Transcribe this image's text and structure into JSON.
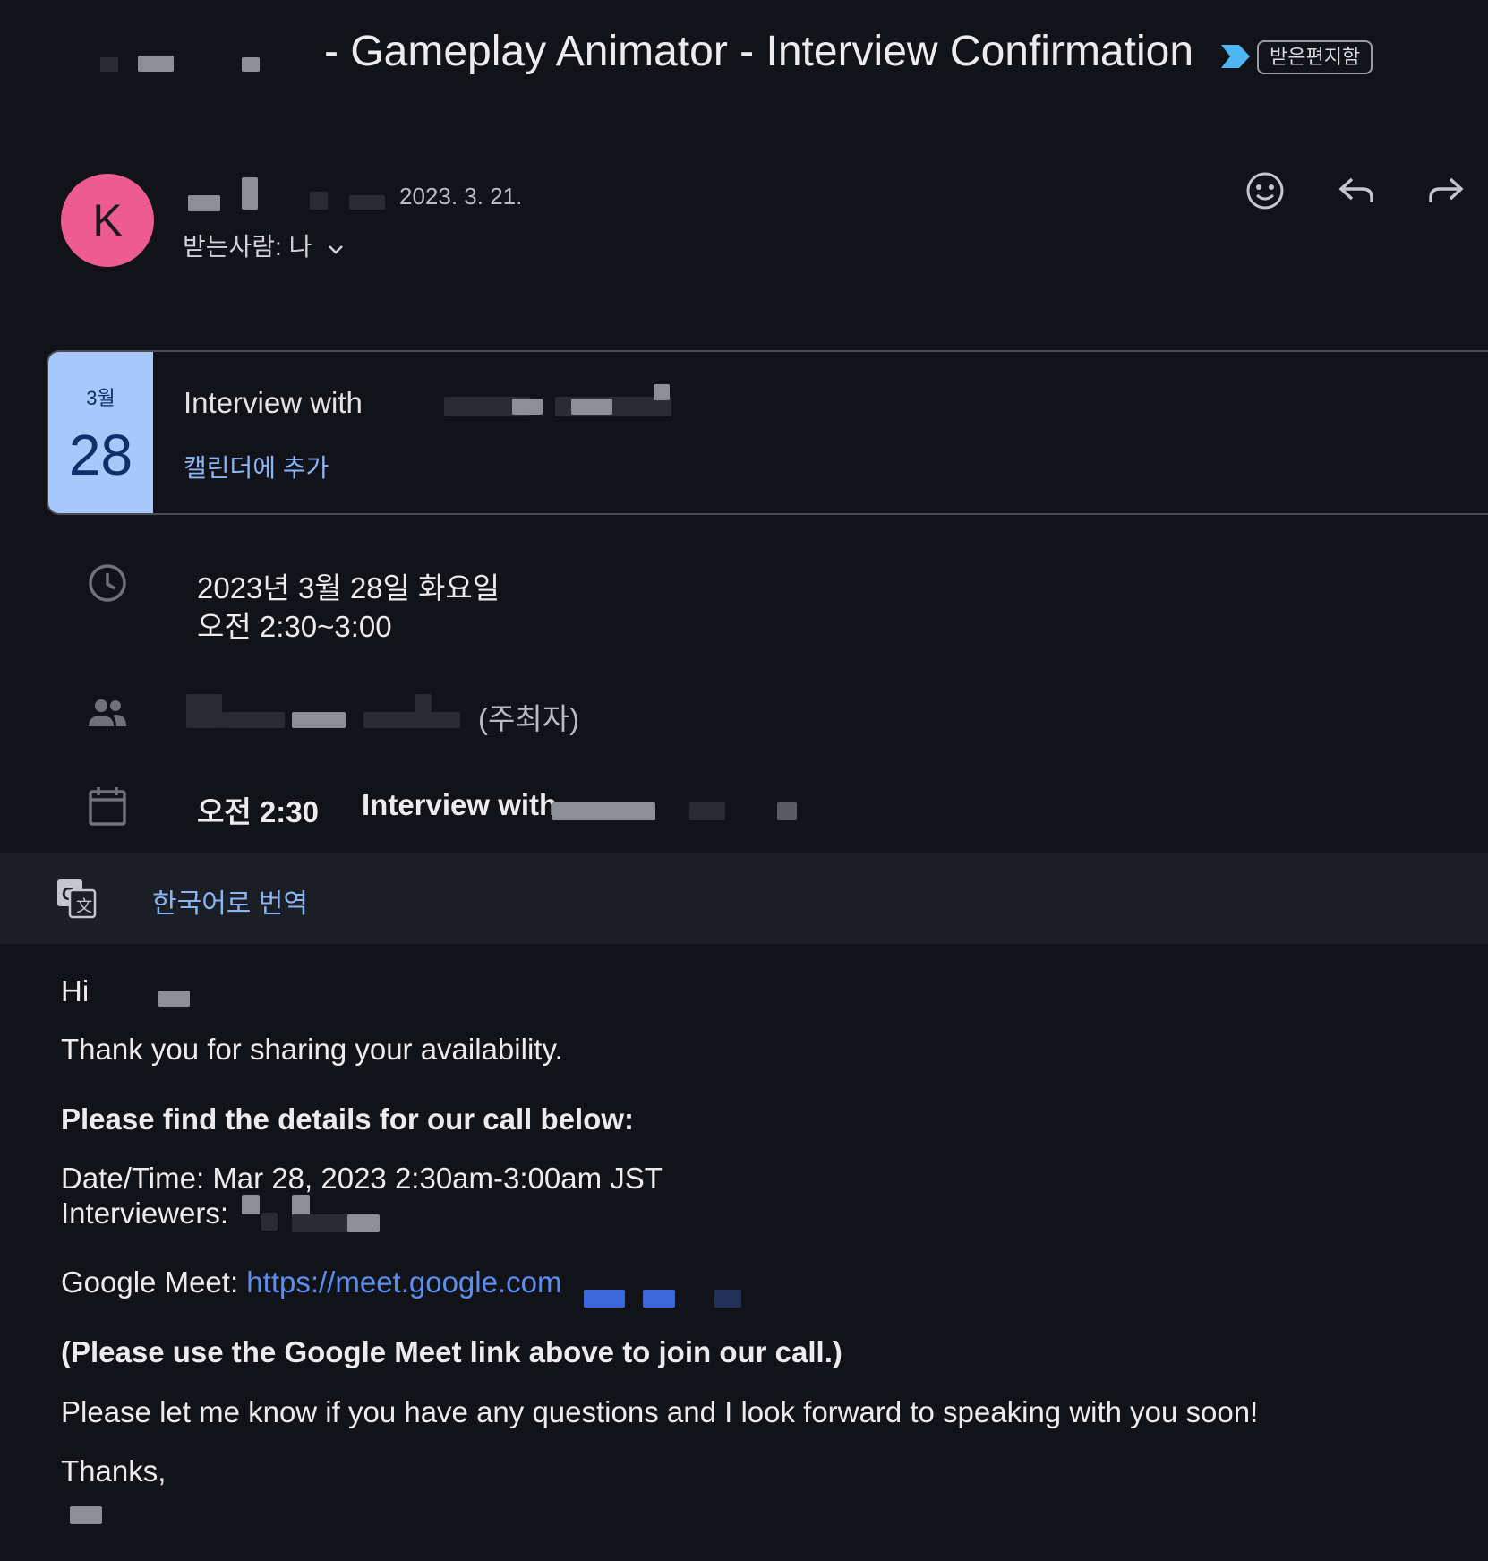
{
  "email": {
    "subject": "- Gameplay Animator - Interview Confirmation",
    "label": "받은편지함",
    "sender_initial": "K",
    "sent_date": "2023. 3. 21.",
    "recipient": "받는사람: 나",
    "actions": [
      "emoji-reaction",
      "reply",
      "forward"
    ]
  },
  "event_card": {
    "month": "3월",
    "day": "28",
    "title": "Interview with",
    "add_to_calendar": "캘린더에 추가"
  },
  "event_details": {
    "date_line": "2023년 3월 28일 화요일",
    "time_line": "오전 2:30~3:00",
    "organizer_suffix": "(주최자)",
    "agenda_time": "오전 2:30",
    "agenda_title": "Interview with"
  },
  "translate": {
    "label": "한국어로 번역"
  },
  "body": {
    "greeting": "Hi",
    "line1": "Thank you for sharing your availability.",
    "line2": "Please find the details for our call below:",
    "datetime": "Date/Time: Mar 28, 2023 2:30am-3:00am JST",
    "interviewers_label": "Interviewers:",
    "meet_label": "Google Meet:",
    "meet_url": "https://meet.google.com",
    "note": "(Please use the Google Meet link above to join our call.)",
    "closing_line": "Please let me know if you have any questions and I look forward to speaking with you soon!",
    "signoff": "Thanks,"
  },
  "colors": {
    "background": "#121318",
    "avatar": "#ee5b8f",
    "card_date_bg": "#a8c7fa",
    "link": "#8ab4f8",
    "label_arrow": "#4db6f5"
  },
  "icons": [
    "label-arrow-icon",
    "emoji-icon",
    "reply-icon",
    "forward-icon",
    "clock-icon",
    "people-icon",
    "calendar-icon",
    "translate-icon",
    "chevron-down-icon"
  ]
}
